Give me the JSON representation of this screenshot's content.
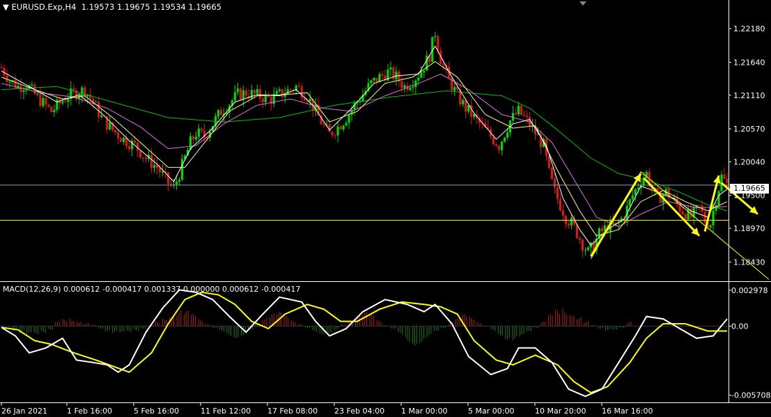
{
  "header": {
    "symbol": "EURUSD.Exp,H4",
    "open": "1.19573",
    "high": "1.19675",
    "low": "1.19534",
    "close": "1.19665"
  },
  "macd_header": {
    "name": "MACD(12,26,9)",
    "values": "0.000612 -0.000417 0.001337 0.000000 0.000612 -0.000417"
  },
  "current_price": "1.19665",
  "colors": {
    "background": "#000000",
    "bull_candle": "#00d800",
    "bear_candle": "#d81818",
    "ma_fast": "#ffffff",
    "ma_mid": "#ffff80",
    "ma_slow": "#e070e0",
    "ma_long": "#00c000",
    "macd_line": "#ffffff",
    "signal_line": "#ffff00",
    "arrows": "#ffff00",
    "support_line": "#ffff00",
    "price_line": "#8ca0b4"
  },
  "chart_data": [
    {
      "type": "candlestick",
      "title": "EURUSD.Exp,H4",
      "price_ticks": [
        "1.22180",
        "1.21640",
        "1.21110",
        "1.20570",
        "1.20040",
        "1.19500",
        "1.18970",
        "1.18430"
      ],
      "price_tick_values": [
        1.2218,
        1.2164,
        1.2111,
        1.2057,
        1.2004,
        1.195,
        1.1897,
        1.1843
      ],
      "ylim": [
        1.1812,
        1.2264
      ],
      "time_labels": [
        "26 Jan 2021",
        "1 Feb 16:00",
        "5 Feb 16:00",
        "11 Feb 12:00",
        "17 Feb 08:00",
        "23 Feb 04:00",
        "1 Mar 00:00",
        "5 Mar 00:00",
        "10 Mar 20:00",
        "16 Mar 16:00"
      ],
      "close_path": [
        [
          0,
          1.2155
        ],
        [
          3,
          1.2135
        ],
        [
          6,
          1.2125
        ],
        [
          9,
          1.2128
        ],
        [
          12,
          1.2112
        ],
        [
          15,
          1.2098
        ],
        [
          18,
          1.2085
        ],
        [
          21,
          1.2098
        ],
        [
          24,
          1.211
        ],
        [
          27,
          1.2115
        ],
        [
          30,
          1.212
        ],
        [
          33,
          1.21
        ],
        [
          36,
          1.2075
        ],
        [
          40,
          1.2055
        ],
        [
          44,
          1.204
        ],
        [
          48,
          1.203
        ],
        [
          52,
          1.201
        ],
        [
          56,
          1.1995
        ],
        [
          60,
          1.197
        ],
        [
          62,
          1.1962
        ],
        [
          64,
          1.1985
        ],
        [
          66,
          1.201
        ],
        [
          68,
          1.2035
        ],
        [
          70,
          1.205
        ],
        [
          73,
          1.2045
        ],
        [
          76,
          1.2065
        ],
        [
          79,
          1.2085
        ],
        [
          82,
          1.2098
        ],
        [
          85,
          1.2112
        ],
        [
          88,
          1.2115
        ],
        [
          91,
          1.2112
        ],
        [
          94,
          1.2108
        ],
        [
          97,
          1.2105
        ],
        [
          100,
          1.2112
        ],
        [
          103,
          1.2118
        ],
        [
          106,
          1.2125
        ],
        [
          110,
          1.211
        ],
        [
          113,
          1.2085
        ],
        [
          116,
          1.206
        ],
        [
          118,
          1.2048
        ],
        [
          121,
          1.206
        ],
        [
          124,
          1.2075
        ],
        [
          127,
          1.2095
        ],
        [
          130,
          1.2112
        ],
        [
          133,
          1.213
        ],
        [
          136,
          1.214
        ],
        [
          139,
          1.2148
        ],
        [
          142,
          1.214
        ],
        [
          145,
          1.2125
        ],
        [
          148,
          1.2135
        ],
        [
          151,
          1.215
        ],
        [
          154,
          1.2175
        ],
        [
          156,
          1.2212
        ],
        [
          158,
          1.217
        ],
        [
          161,
          1.2135
        ],
        [
          164,
          1.211
        ],
        [
          167,
          1.209
        ],
        [
          170,
          1.2075
        ],
        [
          173,
          1.206
        ],
        [
          176,
          1.2045
        ],
        [
          179,
          1.203
        ],
        [
          181,
          1.205
        ],
        [
          183,
          1.207
        ],
        [
          186,
          1.2085
        ],
        [
          189,
          1.207
        ],
        [
          192,
          1.205
        ],
        [
          195,
          1.203
        ],
        [
          197,
          1.1985
        ],
        [
          199,
          1.1955
        ],
        [
          201,
          1.1935
        ],
        [
          203,
          1.1915
        ],
        [
          205,
          1.1905
        ],
        [
          207,
          1.189
        ],
        [
          209,
          1.1872
        ],
        [
          211,
          1.1858
        ],
        [
          213,
          1.187
        ],
        [
          215,
          1.1888
        ],
        [
          218,
          1.19
        ],
        [
          221,
          1.19
        ],
        [
          224,
          1.1918
        ],
        [
          227,
          1.195
        ],
        [
          230,
          1.1975
        ],
        [
          232,
          1.1985
        ],
        [
          234,
          1.196
        ],
        [
          236,
          1.1945
        ],
        [
          239,
          1.1955
        ],
        [
          242,
          1.194
        ],
        [
          245,
          1.1925
        ],
        [
          248,
          1.1915
        ],
        [
          251,
          1.193
        ],
        [
          253,
          1.191
        ],
        [
          255,
          1.1905
        ],
        [
          257,
          1.1945
        ],
        [
          259,
          1.198
        ],
        [
          261,
          1.1967
        ]
      ],
      "ma_fast": [
        [
          0,
          1.215
        ],
        [
          10,
          1.2125
        ],
        [
          20,
          1.21
        ],
        [
          28,
          1.2112
        ],
        [
          36,
          1.2082
        ],
        [
          46,
          1.2038
        ],
        [
          56,
          1.2
        ],
        [
          62,
          1.1972
        ],
        [
          68,
          1.2025
        ],
        [
          76,
          1.2058
        ],
        [
          84,
          1.21
        ],
        [
          92,
          1.2112
        ],
        [
          100,
          1.211
        ],
        [
          106,
          1.212
        ],
        [
          112,
          1.2095
        ],
        [
          118,
          1.2055
        ],
        [
          126,
          1.209
        ],
        [
          134,
          1.213
        ],
        [
          142,
          1.2142
        ],
        [
          150,
          1.2145
        ],
        [
          156,
          1.219
        ],
        [
          162,
          1.214
        ],
        [
          170,
          1.2082
        ],
        [
          178,
          1.204
        ],
        [
          184,
          1.2065
        ],
        [
          190,
          1.2072
        ],
        [
          196,
          1.203
        ],
        [
          202,
          1.1945
        ],
        [
          208,
          1.1895
        ],
        [
          212,
          1.187
        ],
        [
          218,
          1.1895
        ],
        [
          224,
          1.1912
        ],
        [
          230,
          1.1965
        ],
        [
          236,
          1.1955
        ],
        [
          242,
          1.1945
        ],
        [
          248,
          1.1925
        ],
        [
          254,
          1.1915
        ],
        [
          258,
          1.195
        ],
        [
          261,
          1.196
        ]
      ],
      "ma_mid": [
        [
          0,
          1.214
        ],
        [
          12,
          1.212
        ],
        [
          22,
          1.2105
        ],
        [
          30,
          1.211
        ],
        [
          40,
          1.2075
        ],
        [
          50,
          1.2035
        ],
        [
          60,
          1.1995
        ],
        [
          66,
          1.1995
        ],
        [
          74,
          1.204
        ],
        [
          82,
          1.2085
        ],
        [
          92,
          1.211
        ],
        [
          102,
          1.2112
        ],
        [
          110,
          1.2115
        ],
        [
          118,
          1.2068
        ],
        [
          128,
          1.2085
        ],
        [
          138,
          1.213
        ],
        [
          148,
          1.214
        ],
        [
          156,
          1.2165
        ],
        [
          164,
          1.214
        ],
        [
          174,
          1.208
        ],
        [
          184,
          1.2058
        ],
        [
          192,
          1.2062
        ],
        [
          200,
          1.199
        ],
        [
          208,
          1.1925
        ],
        [
          214,
          1.1885
        ],
        [
          222,
          1.1895
        ],
        [
          230,
          1.194
        ],
        [
          238,
          1.1958
        ],
        [
          246,
          1.194
        ],
        [
          254,
          1.1925
        ],
        [
          261,
          1.194
        ]
      ],
      "ma_slow": [
        [
          0,
          1.213
        ],
        [
          14,
          1.2115
        ],
        [
          26,
          1.2108
        ],
        [
          38,
          1.209
        ],
        [
          50,
          1.206
        ],
        [
          60,
          1.2025
        ],
        [
          70,
          1.203
        ],
        [
          80,
          1.2065
        ],
        [
          92,
          1.2095
        ],
        [
          104,
          1.2105
        ],
        [
          116,
          1.209
        ],
        [
          126,
          1.2085
        ],
        [
          138,
          1.211
        ],
        [
          150,
          1.213
        ],
        [
          158,
          1.2145
        ],
        [
          168,
          1.212
        ],
        [
          180,
          1.208
        ],
        [
          190,
          1.2068
        ],
        [
          198,
          1.2035
        ],
        [
          206,
          1.1975
        ],
        [
          214,
          1.1915
        ],
        [
          222,
          1.19
        ],
        [
          230,
          1.192
        ],
        [
          240,
          1.194
        ],
        [
          250,
          1.193
        ],
        [
          261,
          1.1932
        ]
      ],
      "ma_long": [
        [
          0,
          1.212
        ],
        [
          20,
          1.2125
        ],
        [
          40,
          1.21
        ],
        [
          60,
          1.2075
        ],
        [
          80,
          1.2068
        ],
        [
          100,
          1.2075
        ],
        [
          120,
          1.2095
        ],
        [
          140,
          1.2108
        ],
        [
          160,
          1.2118
        ],
        [
          180,
          1.211
        ],
        [
          190,
          1.209
        ],
        [
          200,
          1.2055
        ],
        [
          212,
          1.201
        ],
        [
          222,
          1.1985
        ],
        [
          232,
          1.1975
        ],
        [
          244,
          1.1955
        ],
        [
          254,
          1.1935
        ],
        [
          261,
          1.1925
        ]
      ],
      "support_level": 1.191,
      "trendline": [
        [
          212,
          1.1848
        ],
        [
          230,
          1.1988
        ],
        [
          276,
          1.1815
        ]
      ],
      "arrows": [
        {
          "from": [
            212,
            1.1852
          ],
          "to": [
            230,
            1.1985
          ]
        },
        {
          "from": [
            231,
            1.1978
          ],
          "to": [
            251,
            1.1885
          ]
        },
        {
          "from": [
            253,
            1.1892
          ],
          "to": [
            258,
            1.1982
          ]
        },
        {
          "from": [
            259,
            1.197
          ],
          "to": [
            272,
            1.192
          ]
        }
      ]
    },
    {
      "type": "macd",
      "title": "MACD(12,26,9)",
      "ticks": [
        "0.002978",
        "0.00",
        "-0.005708"
      ],
      "tick_values": [
        0.002978,
        0.0,
        -0.005708
      ],
      "ylim": [
        -0.0063,
        0.0036
      ],
      "macd_line": [
        [
          0,
          -0.0001
        ],
        [
          5,
          -0.0008
        ],
        [
          10,
          -0.0022
        ],
        [
          16,
          -0.0018
        ],
        [
          22,
          -0.001
        ],
        [
          27,
          -0.0028
        ],
        [
          33,
          -0.003
        ],
        [
          38,
          -0.0032
        ],
        [
          42,
          -0.0038
        ],
        [
          46,
          -0.0032
        ],
        [
          52,
          -0.0005
        ],
        [
          58,
          0.0015
        ],
        [
          64,
          0.003
        ],
        [
          70,
          0.0028
        ],
        [
          76,
          0.0022
        ],
        [
          82,
          0.0008
        ],
        [
          88,
          -0.0005
        ],
        [
          94,
          0.001
        ],
        [
          100,
          0.0024
        ],
        [
          108,
          0.002
        ],
        [
          113,
          0.0004
        ],
        [
          118,
          -0.0008
        ],
        [
          124,
          -0.0002
        ],
        [
          130,
          0.0012
        ],
        [
          138,
          0.0022
        ],
        [
          146,
          0.0018
        ],
        [
          152,
          0.0012
        ],
        [
          156,
          0.0018
        ],
        [
          162,
          0.0002
        ],
        [
          168,
          -0.0025
        ],
        [
          176,
          -0.004
        ],
        [
          182,
          -0.0035
        ],
        [
          186,
          -0.0018
        ],
        [
          192,
          -0.0018
        ],
        [
          198,
          -0.003
        ],
        [
          204,
          -0.0052
        ],
        [
          210,
          -0.0058
        ],
        [
          216,
          -0.0052
        ],
        [
          222,
          -0.003
        ],
        [
          228,
          -0.0008
        ],
        [
          232,
          0.0008
        ],
        [
          238,
          0.0006
        ],
        [
          244,
          -0.0002
        ],
        [
          250,
          -0.001
        ],
        [
          256,
          -0.0008
        ],
        [
          261,
          0.0006
        ]
      ],
      "signal_line": [
        [
          0,
          -0.0001
        ],
        [
          6,
          -0.0003
        ],
        [
          12,
          -0.0012
        ],
        [
          18,
          -0.0015
        ],
        [
          26,
          -0.0022
        ],
        [
          34,
          -0.0028
        ],
        [
          40,
          -0.0033
        ],
        [
          46,
          -0.0038
        ],
        [
          54,
          -0.0022
        ],
        [
          60,
          0.0002
        ],
        [
          66,
          0.0022
        ],
        [
          72,
          0.0028
        ],
        [
          78,
          0.0026
        ],
        [
          84,
          0.0018
        ],
        [
          90,
          0.0004
        ],
        [
          96,
          -0.0002
        ],
        [
          102,
          0.001
        ],
        [
          110,
          0.0018
        ],
        [
          116,
          0.0014
        ],
        [
          122,
          0.0004
        ],
        [
          128,
          0.0004
        ],
        [
          136,
          0.0014
        ],
        [
          144,
          0.002
        ],
        [
          152,
          0.0018
        ],
        [
          158,
          0.0016
        ],
        [
          164,
          0.001
        ],
        [
          170,
          -0.0012
        ],
        [
          178,
          -0.0028
        ],
        [
          184,
          -0.0032
        ],
        [
          192,
          -0.0024
        ],
        [
          200,
          -0.0032
        ],
        [
          206,
          -0.0046
        ],
        [
          212,
          -0.0055
        ],
        [
          218,
          -0.005
        ],
        [
          226,
          -0.003
        ],
        [
          232,
          -0.001
        ],
        [
          238,
          0.0002
        ],
        [
          246,
          0.0002
        ],
        [
          254,
          -0.0004
        ],
        [
          261,
          -0.0004
        ]
      ],
      "histogram": [
        0.0,
        -0.0004,
        -0.0006,
        -0.0008,
        -0.0009,
        -0.0006,
        -0.0003,
        0.0004,
        0.0006,
        0.0007,
        0.0005,
        0.0003,
        0.0001,
        -0.0002,
        -0.0004,
        -0.0006,
        -0.0007,
        -0.0006,
        -0.0004,
        -0.0002,
        0.0001,
        0.0004,
        0.0008,
        0.0012,
        0.0014,
        0.0013,
        0.001,
        0.0006,
        0.0002,
        -0.0002,
        -0.0005,
        -0.0008,
        -0.001,
        -0.0008,
        -0.0004,
        0.0003,
        0.0008,
        0.0011,
        0.0012,
        0.0009,
        0.0005,
        0.0002,
        -0.0002,
        -0.0005,
        -0.0007,
        -0.0006,
        -0.0003,
        0.0002,
        0.0006,
        0.001,
        0.0012,
        0.001,
        0.0005,
        0.0001,
        -0.0003,
        -0.0008,
        -0.0013,
        -0.0016,
        -0.0014,
        -0.001,
        -0.0006,
        -0.0002,
        0.0003,
        0.0007,
        0.001,
        0.0008,
        0.0004,
        0.0,
        -0.0004,
        -0.0008,
        -0.0011,
        -0.0012,
        -0.001,
        -0.0006,
        -0.0002,
        0.0004,
        0.001,
        0.0014,
        0.0016,
        0.0013,
        0.0009,
        0.0004,
        0.0001,
        -0.0002,
        -0.0004,
        -0.0004,
        -0.0002,
        0.0004,
        0.0008,
        0.001
      ]
    }
  ]
}
